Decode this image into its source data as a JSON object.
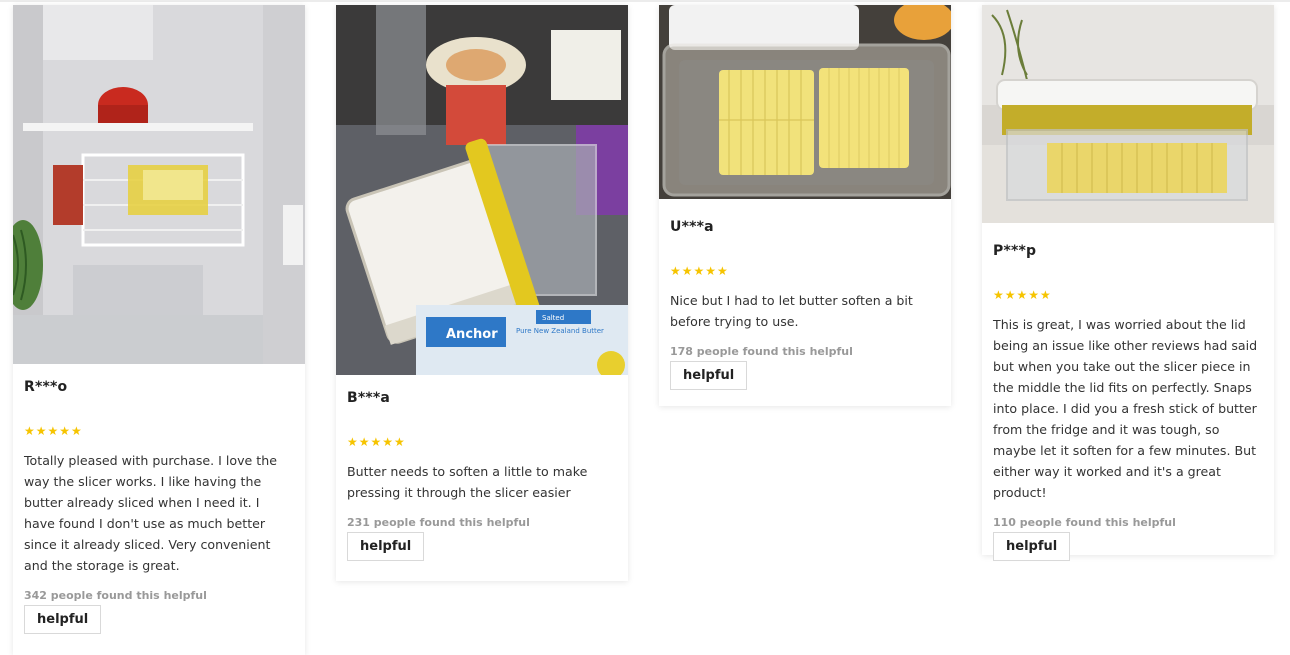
{
  "reviews": [
    {
      "author": "R***o",
      "stars": "★★★★★",
      "text": "Totally pleased with purchase. I love the way the slicer works. I like having the butter already sliced when I need it. I have found I don't use as much better since it already sliced. Very convenient and the storage is great.",
      "helpful_count": "342 people found this helpful",
      "helpful_label": "helpful"
    },
    {
      "author": "B***a",
      "stars": "★★★★★",
      "text": "Butter needs to soften a little to make pressing it through the slicer easier",
      "helpful_count": "231 people found this helpful",
      "helpful_label": "helpful",
      "photo_text": {
        "brand": "Anchor",
        "product": "Pure New Zealand Butter",
        "variant": "Salted"
      }
    },
    {
      "author": "U***a",
      "stars": "★★★★★",
      "text": "Nice but I had to let butter soften a bit before trying to use.",
      "helpful_count": "178 people found this helpful",
      "helpful_label": "helpful"
    },
    {
      "author": "P***p",
      "stars": "★★★★★",
      "text": "This is great, I was worried about the lid being an issue like other reviews had said but when you take out the slicer piece in the middle the lid fits on perfectly. Snaps into place. I did you a fresh stick of butter from the fridge and it was tough, so maybe let it soften for a few minutes. But either way it worked and it's a great product!",
      "helpful_count": "110 people found this helpful",
      "helpful_label": "helpful"
    }
  ],
  "colors": {
    "star": "#f6c400",
    "butter": "#f3e27a",
    "lid_yellow": "#e8cf2e"
  },
  "icons": {
    "rating": "star-icon"
  }
}
